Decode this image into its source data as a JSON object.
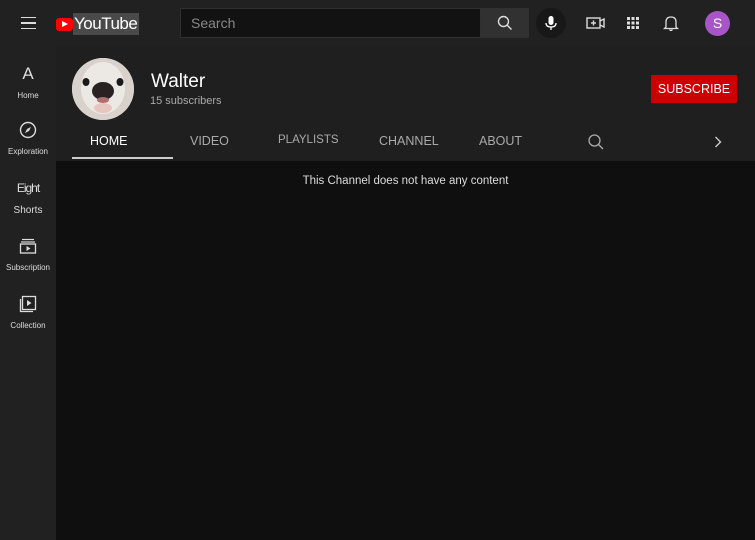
{
  "header": {
    "logo_text": "YouTube",
    "search_placeholder": "Search",
    "avatar_initial": "S",
    "avatar_color": "#a855c7",
    "icons": [
      "menu-icon",
      "search-icon",
      "microphone-icon",
      "create-video-icon",
      "apps-grid-icon",
      "notifications-bell-icon"
    ]
  },
  "sidebar": {
    "items": [
      {
        "icon_glyph": "A",
        "label": "Home"
      },
      {
        "icon_glyph": "",
        "label": "Exploration"
      },
      {
        "icon_glyph": "Eight",
        "label": "Shorts"
      },
      {
        "icon_glyph": "",
        "label": "Subscription"
      },
      {
        "icon_glyph": "",
        "label": "Collection"
      }
    ]
  },
  "channel": {
    "name": "Walter",
    "subscribers": "15 subscribers",
    "subscribe_label": "SUBSCRIBE",
    "tabs": [
      "HOME",
      "VIDEO",
      "PLAYLISTS",
      "CHANNEL",
      "ABOUT"
    ],
    "active_tab": "HOME"
  },
  "content": {
    "empty_message": "This Channel does not have any content"
  },
  "colors": {
    "brand_red": "#ff0000",
    "subscribe_red": "#cc0000",
    "background": "#0f0f0f",
    "surface": "#212121"
  }
}
